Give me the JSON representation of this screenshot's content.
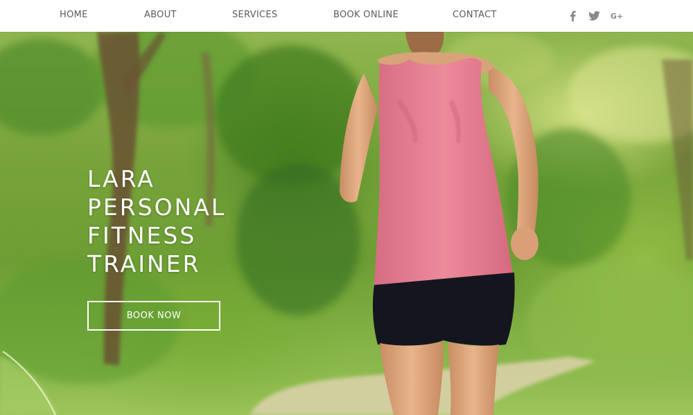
{
  "nav": {
    "items": [
      {
        "label": "HOME"
      },
      {
        "label": "ABOUT"
      },
      {
        "label": "SERVICES"
      },
      {
        "label": "BOOK ONLINE"
      },
      {
        "label": "CONTACT"
      }
    ]
  },
  "social": {
    "facebook_icon": "facebook-icon",
    "twitter_icon": "twitter-icon",
    "googleplus_label": "G+"
  },
  "hero": {
    "title_lines": [
      "LARA",
      "PERSONAL",
      "FITNESS",
      "TRAINER"
    ],
    "button_label": "BOOK NOW",
    "image": "woman-running-on-forest-path"
  },
  "colors": {
    "nav_text": "#5a5a5a",
    "icon": "#8a8a8a",
    "hero_text": "#ffffff",
    "tank_top": "#e3788c",
    "shorts": "#111122",
    "foliage": "#6d9d34"
  }
}
